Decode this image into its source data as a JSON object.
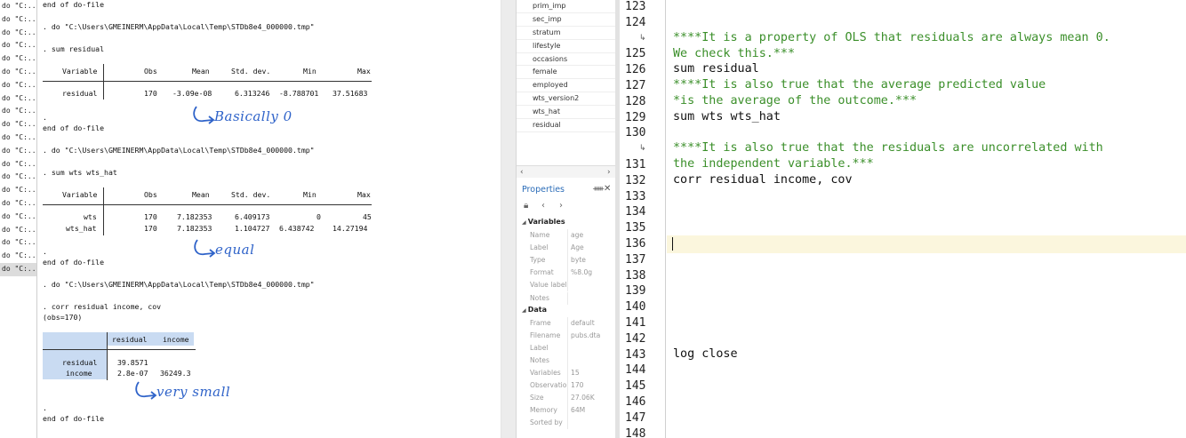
{
  "history": {
    "items": [
      "do \"C:...",
      "do \"C:...",
      "do \"C:...",
      "do \"C:...",
      "do \"C:...",
      "do \"C:...",
      "do \"C:...",
      "do \"C:...",
      "do \"C:...",
      "do \"C:...",
      "do \"C:...",
      "do \"C:...",
      "do \"C:...",
      "do \"C:...",
      "do \"C:...",
      "do \"C:...",
      "do \"C:...",
      "do \"C:...",
      "do \"C:...",
      "do \"C:...",
      "do \"C:..."
    ]
  },
  "results": {
    "end_dofile": "end of do-file",
    "do_line": ". do \"C:\\Users\\GMEINERM\\AppData\\Local\\Temp\\STDb8e4_000000.tmp\"",
    "dot": ".",
    "cmd1": ". sum residual",
    "cmd2": ". sum wts wts_hat",
    "cmd3": ". corr residual income, cov",
    "obs_note": "(obs=170)",
    "sum_headers": [
      "Variable",
      "Obs",
      "Mean",
      "Std. dev.",
      "Min",
      "Max"
    ],
    "sum1_rows": [
      {
        "var": "residual",
        "obs": "170",
        "mean": "-3.09e-08",
        "sd": "6.313246",
        "min": "-8.788701",
        "max": "37.51683"
      }
    ],
    "sum2_rows": [
      {
        "var": "wts",
        "obs": "170",
        "mean": "7.182353",
        "sd": "6.409173",
        "min": "0",
        "max": "45"
      },
      {
        "var": "wts_hat",
        "obs": "170",
        "mean": "7.182353",
        "sd": "1.104727",
        "min": "6.438742",
        "max": "14.27194"
      }
    ],
    "corr_headers": [
      "residual",
      "income"
    ],
    "corr_rows": [
      {
        "var": "residual",
        "c1": "39.8571",
        "c2": ""
      },
      {
        "var": "income",
        "c1": "2.8e-07",
        "c2": "36249.3"
      }
    ],
    "annotations": {
      "note1": "Basically 0",
      "note2": "equal",
      "note3": "very small"
    }
  },
  "variables": {
    "items": [
      "prim_imp",
      "sec_imp",
      "stratum",
      "lifestyle",
      "occasions",
      "female",
      "employed",
      "wts_version2",
      "wts_hat",
      "residual"
    ]
  },
  "properties": {
    "title": "Properties",
    "pin": "ᚔ",
    "close": "✕",
    "sections": [
      {
        "label": "Variables",
        "rows": [
          {
            "k": "Name",
            "v": "age"
          },
          {
            "k": "Label",
            "v": "Age"
          },
          {
            "k": "Type",
            "v": "byte"
          },
          {
            "k": "Format",
            "v": "%8.0g"
          },
          {
            "k": "Value label",
            "v": ""
          },
          {
            "k": "Notes",
            "v": ""
          }
        ]
      },
      {
        "label": "Data",
        "rows": [
          {
            "k": "Frame",
            "v": "default"
          },
          {
            "k": "Filename",
            "v": "pubs.dta"
          },
          {
            "k": "Label",
            "v": ""
          },
          {
            "k": "Notes",
            "v": ""
          },
          {
            "k": "Variables",
            "v": "15"
          },
          {
            "k": "Observatio",
            "v": "170"
          },
          {
            "k": "Size",
            "v": "27.06K"
          },
          {
            "k": "Memory",
            "v": "64M"
          },
          {
            "k": "Sorted by",
            "v": ""
          }
        ]
      }
    ]
  },
  "editor": {
    "line_numbers": [
      "123",
      "124",
      "125",
      "126",
      "127",
      "128",
      "129",
      "130",
      "131",
      "132",
      "133",
      "134",
      "135",
      "136",
      "137",
      "138",
      "139",
      "140",
      "141",
      "142",
      "143",
      "144",
      "145",
      "146",
      "147",
      "148"
    ],
    "lines": [
      {
        "text": "****It is a property of OLS that residuals are always mean 0.",
        "kind": "cmt"
      },
      {
        "text": "We check this.***",
        "kind": "cmt"
      },
      {
        "text": "sum residual",
        "kind": "cmd"
      },
      {
        "text": "****It is also true that the average predicted value",
        "kind": "cmt"
      },
      {
        "text": "*is the average of the outcome.***",
        "kind": "cmt"
      },
      {
        "text": "sum wts wts_hat",
        "kind": "cmd"
      },
      {
        "text": "****It is also true that the residuals are uncorrelated with",
        "kind": "cmt"
      },
      {
        "text": "the independent variable.***",
        "kind": "cmt"
      },
      {
        "text": "corr residual income, cov",
        "kind": "cmd"
      },
      {
        "text": "log close",
        "kind": "cmd"
      }
    ],
    "wrap_mark": "↳"
  },
  "colors": {
    "comment": "#3b8f2a",
    "annotation_ink": "#2f63c9",
    "highlight": "#c9dbf2",
    "current_line": "#fbf6dd"
  }
}
